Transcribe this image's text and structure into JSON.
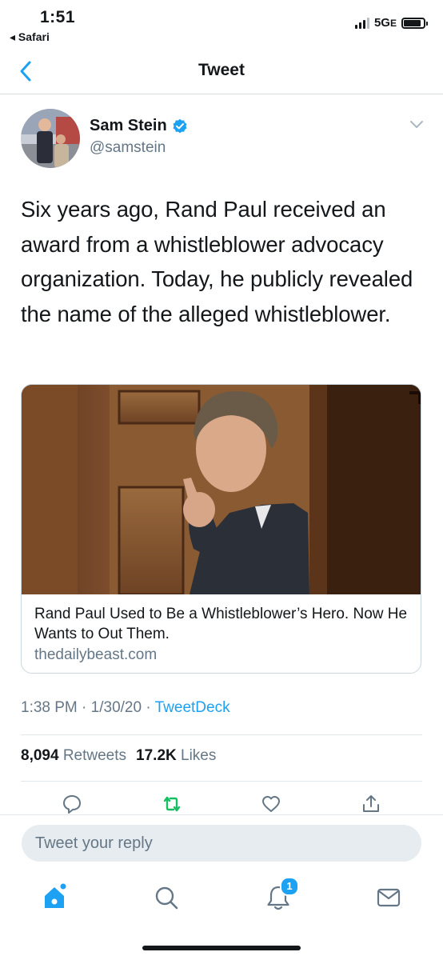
{
  "status_bar": {
    "time": "1:51",
    "back_app": "◂ Safari",
    "network": "5G",
    "network_suffix": "E"
  },
  "nav": {
    "title": "Tweet",
    "back_icon": "chevron-left-icon"
  },
  "tweet": {
    "author_name": "Sam Stein",
    "author_handle": "@samstein",
    "verified": true,
    "text": "Six years ago, Rand Paul received an award from a whistleblower advocacy organization. Today, he publicly revealed the name of the alleged whistleblower.",
    "card": {
      "title": "Rand Paul Used to Be a Whistleblower’s Hero. Now He Wants to Out Them.",
      "domain": "thedailybeast.com"
    },
    "meta": {
      "time": "1:38 PM",
      "separator": "·",
      "date": "1/30/20",
      "source": "TweetDeck"
    },
    "stats": {
      "retweets_count": "8,094",
      "retweets_label": "Retweets",
      "likes_count": "17.2K",
      "likes_label": "Likes"
    }
  },
  "actions": [
    "reply-icon",
    "retweet-icon",
    "like-icon",
    "share-icon"
  ],
  "reply": {
    "placeholder": "Tweet your reply"
  },
  "tab_bar": {
    "tabs": [
      "home-icon",
      "search-icon",
      "notifications-icon",
      "messages-icon"
    ],
    "notifications_badge": "1"
  },
  "colors": {
    "accent": "#1da1f2",
    "retweet": "#17bf63",
    "secondary_text": "#657786",
    "text": "#14171a"
  }
}
